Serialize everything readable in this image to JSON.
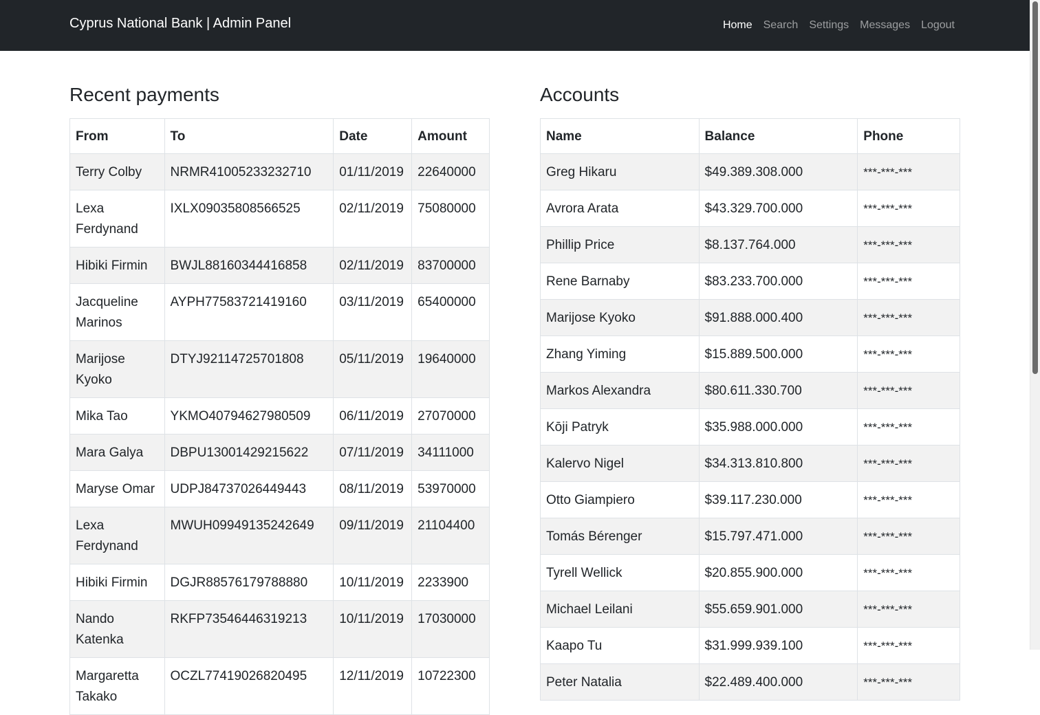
{
  "navbar": {
    "brand": "Cyprus National Bank | Admin Panel",
    "links": [
      "Home",
      "Search",
      "Settings",
      "Messages",
      "Logout"
    ],
    "active": "Home"
  },
  "payments": {
    "title": "Recent payments",
    "headers": [
      "From",
      "To",
      "Date",
      "Amount"
    ],
    "rows": [
      [
        "Terry Colby",
        "NRMR41005233232710",
        "01/11/2019",
        "22640000"
      ],
      [
        "Lexa Ferdynand",
        "IXLX09035808566525",
        "02/11/2019",
        "75080000"
      ],
      [
        "Hibiki Firmin",
        "BWJL88160344416858",
        "02/11/2019",
        "83700000"
      ],
      [
        "Jacqueline Marinos",
        "AYPH77583721419160",
        "03/11/2019",
        "65400000"
      ],
      [
        "Marijose Kyoko",
        "DTYJ92114725701808",
        "05/11/2019",
        "19640000"
      ],
      [
        "Mika Tao",
        "YKMO40794627980509",
        "06/11/2019",
        "27070000"
      ],
      [
        "Mara Galya",
        "DBPU13001429215622",
        "07/11/2019",
        "34111000"
      ],
      [
        "Maryse Omar",
        "UDPJ84737026449443",
        "08/11/2019",
        "53970000"
      ],
      [
        "Lexa Ferdynand",
        "MWUH09949135242649",
        "09/11/2019",
        "21104400"
      ],
      [
        "Hibiki Firmin",
        "DGJR88576179788880",
        "10/11/2019",
        "2233900"
      ],
      [
        "Nando Katenka",
        "RKFP73546446319213",
        "10/11/2019",
        "17030000"
      ],
      [
        "Margaretta Takako",
        "OCZL77419026820495",
        "12/11/2019",
        "10722300"
      ]
    ]
  },
  "accounts": {
    "title": "Accounts",
    "headers": [
      "Name",
      "Balance",
      "Phone"
    ],
    "rows": [
      [
        "Greg Hikaru",
        "$49.389.308.000",
        "***-***-***"
      ],
      [
        "Avrora Arata",
        "$43.329.700.000",
        "***-***-***"
      ],
      [
        "Phillip Price",
        "$8.137.764.000",
        "***-***-***"
      ],
      [
        "Rene Barnaby",
        "$83.233.700.000",
        "***-***-***"
      ],
      [
        "Marijose Kyoko",
        "$91.888.000.400",
        "***-***-***"
      ],
      [
        "Zhang Yiming",
        "$15.889.500.000",
        "***-***-***"
      ],
      [
        "Markos Alexandra",
        "$80.611.330.700",
        "***-***-***"
      ],
      [
        "Kōji Patryk",
        "$35.988.000.000",
        "***-***-***"
      ],
      [
        "Kalervo Nigel",
        "$34.313.810.800",
        "***-***-***"
      ],
      [
        "Otto Giampiero",
        "$39.117.230.000",
        "***-***-***"
      ],
      [
        "Tomás Bérenger",
        "$15.797.471.000",
        "***-***-***"
      ],
      [
        "Tyrell Wellick",
        "$20.855.900.000",
        "***-***-***"
      ],
      [
        "Michael Leilani",
        "$55.659.901.000",
        "***-***-***"
      ],
      [
        "Kaapo Tu",
        "$31.999.939.100",
        "***-***-***"
      ],
      [
        "Peter Natalia",
        "$22.489.400.000",
        "***-***-***"
      ]
    ]
  },
  "colors": {
    "navbar_bg": "#212529",
    "stripe": "#f2f2f2",
    "border": "#dee2e6"
  }
}
